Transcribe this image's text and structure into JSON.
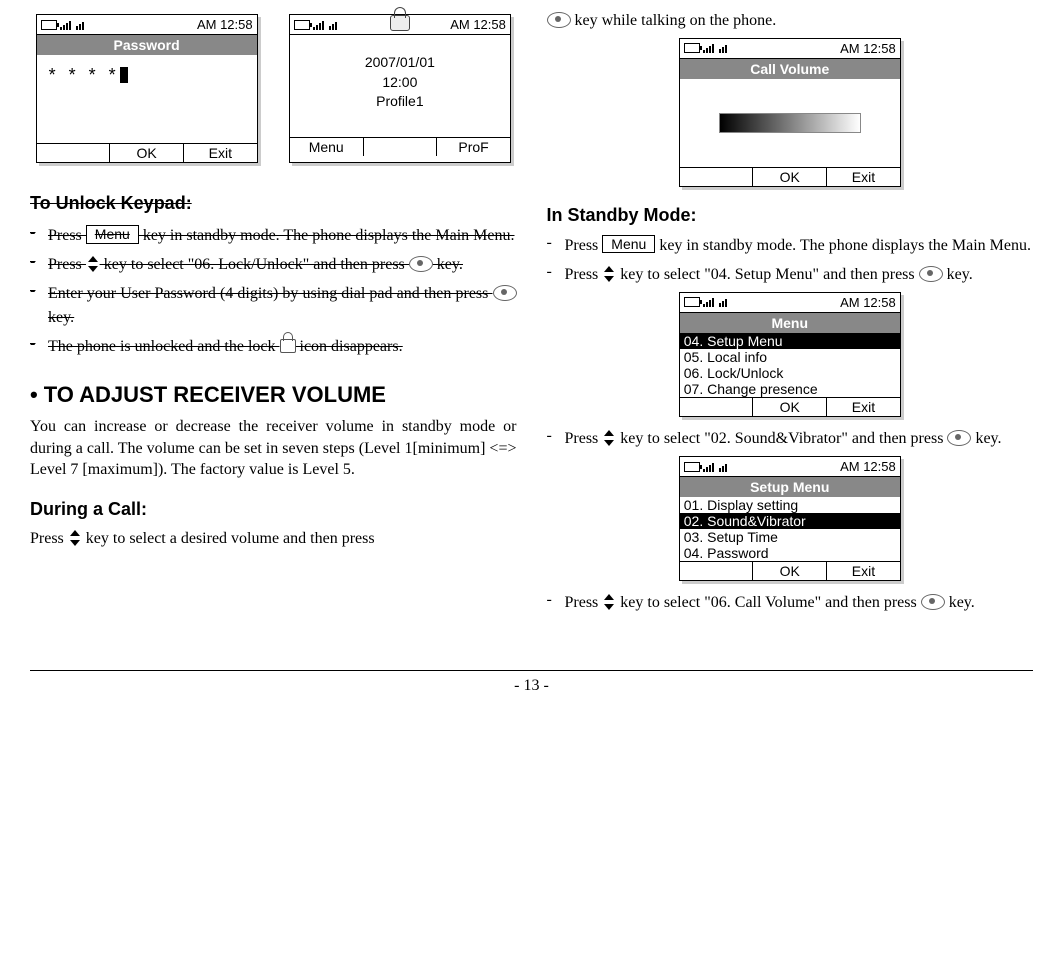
{
  "clock": "AM 12:58",
  "phone_password": {
    "title": "Password",
    "value": "* * * *",
    "soft_left": "",
    "soft_mid": "OK",
    "soft_right": "Exit"
  },
  "phone_standby": {
    "line1": "2007/01/01",
    "line2": "12:00",
    "line3": "Profile1",
    "soft_left": "Menu",
    "soft_mid": "",
    "soft_right": "ProF"
  },
  "phone_call_volume": {
    "title": "Call Volume",
    "soft_left": "",
    "soft_mid": "OK",
    "soft_right": "Exit"
  },
  "phone_main_menu": {
    "title": "Menu",
    "items": [
      "04. Setup Menu",
      "05. Local info",
      "06. Lock/Unlock",
      "07. Change presence"
    ],
    "selected_index": 0,
    "soft_left": "",
    "soft_mid": "OK",
    "soft_right": "Exit"
  },
  "phone_setup_menu": {
    "title": "Setup Menu",
    "items": [
      "01. Display setting",
      "02. Sound&Vibrator",
      "03. Setup Time",
      "04. Password"
    ],
    "selected_index": 1,
    "soft_left": "",
    "soft_mid": "OK",
    "soft_right": "Exit"
  },
  "keys": {
    "menu": "Menu"
  },
  "left": {
    "h_unlock": "To Unlock Keypad:",
    "b1a": "Press ",
    "b1b": " key in standby mode. The phone displays the Main Menu.",
    "b2a": "Press ",
    "b2b": " key to select \"06. Lock/Unlock\" and then press ",
    "b2c": " key.",
    "b3a": "Enter your User Password (4 digits) by using dial pad and then press ",
    "b3b": " key.",
    "b4a": "The phone is unlocked and the lock ",
    "b4b": "  icon disappears.",
    "h_volume": "TO ADJUST RECEIVER VOLUME",
    "vol_para": "You can increase or decrease the receiver volume in standby mode or during a call. The volume can be set in seven steps (Level 1[minimum] <=> Level 7 [maximum]). The factory value is Level 5.",
    "h_during": "During a Call:",
    "during_a": "Press ",
    "during_b": " key to select a desired volume and then press"
  },
  "right": {
    "top_tail": " key while talking on the phone.",
    "h_standby": "In Standby Mode:",
    "s1a": "Press ",
    "s1b": " key in standby mode. The phone displays the Main Menu.",
    "s2a": "Press ",
    "s2b": " key to select \"04. Setup Menu\" and then press ",
    "s2c": " key.",
    "s3a": "Press ",
    "s3b": " key to select \"02. Sound&Vibrator\" and then press ",
    "s3c": " key.",
    "s4a": "Press ",
    "s4b": " key to select \"06. Call Volume\" and then press ",
    "s4c": " key."
  },
  "page_number": "- 13 -"
}
